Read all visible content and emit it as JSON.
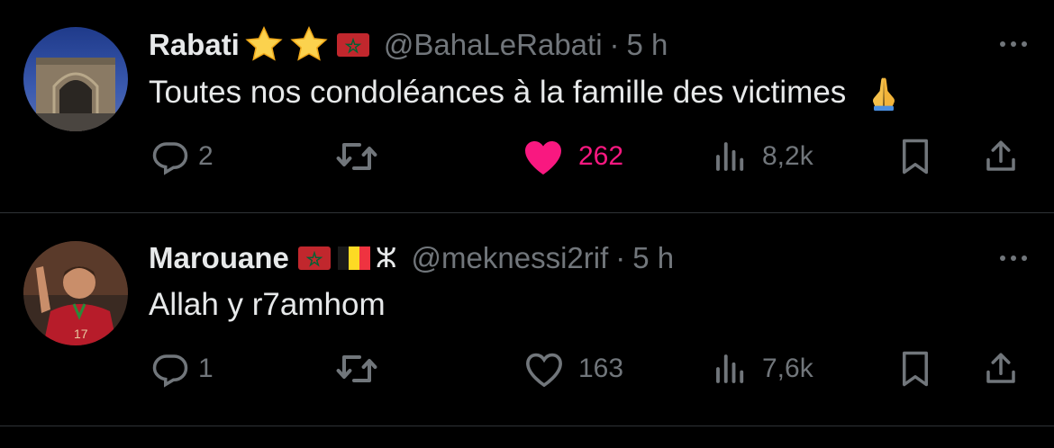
{
  "tweets": [
    {
      "name": "Rabati",
      "handle": "@BahaLeRabati",
      "sep": "·",
      "time": "5 h",
      "badges": [
        "star-emoji",
        "star-emoji",
        "morocco-flag"
      ],
      "text": "Toutes nos condoléances à la famille des victimes",
      "text_emoji": "praying-hands-emoji",
      "replies": "2",
      "likes": "262",
      "liked": true,
      "views": "8,2k"
    },
    {
      "name": "Marouane",
      "handle": "@meknessi2rif",
      "sep": "·",
      "time": "5 h",
      "badges": [
        "morocco-flag",
        "belgium-flag",
        "amazigh-symbol"
      ],
      "amazigh_glyph": "ⵣ",
      "text": "Allah y r7amhom",
      "replies": "1",
      "likes": "163",
      "liked": false,
      "views": "7,6k"
    }
  ],
  "colors": {
    "background": "#000000",
    "text": "#e7e9ea",
    "muted": "#71767b",
    "like_active": "#f91880",
    "divider": "#2f3336"
  }
}
